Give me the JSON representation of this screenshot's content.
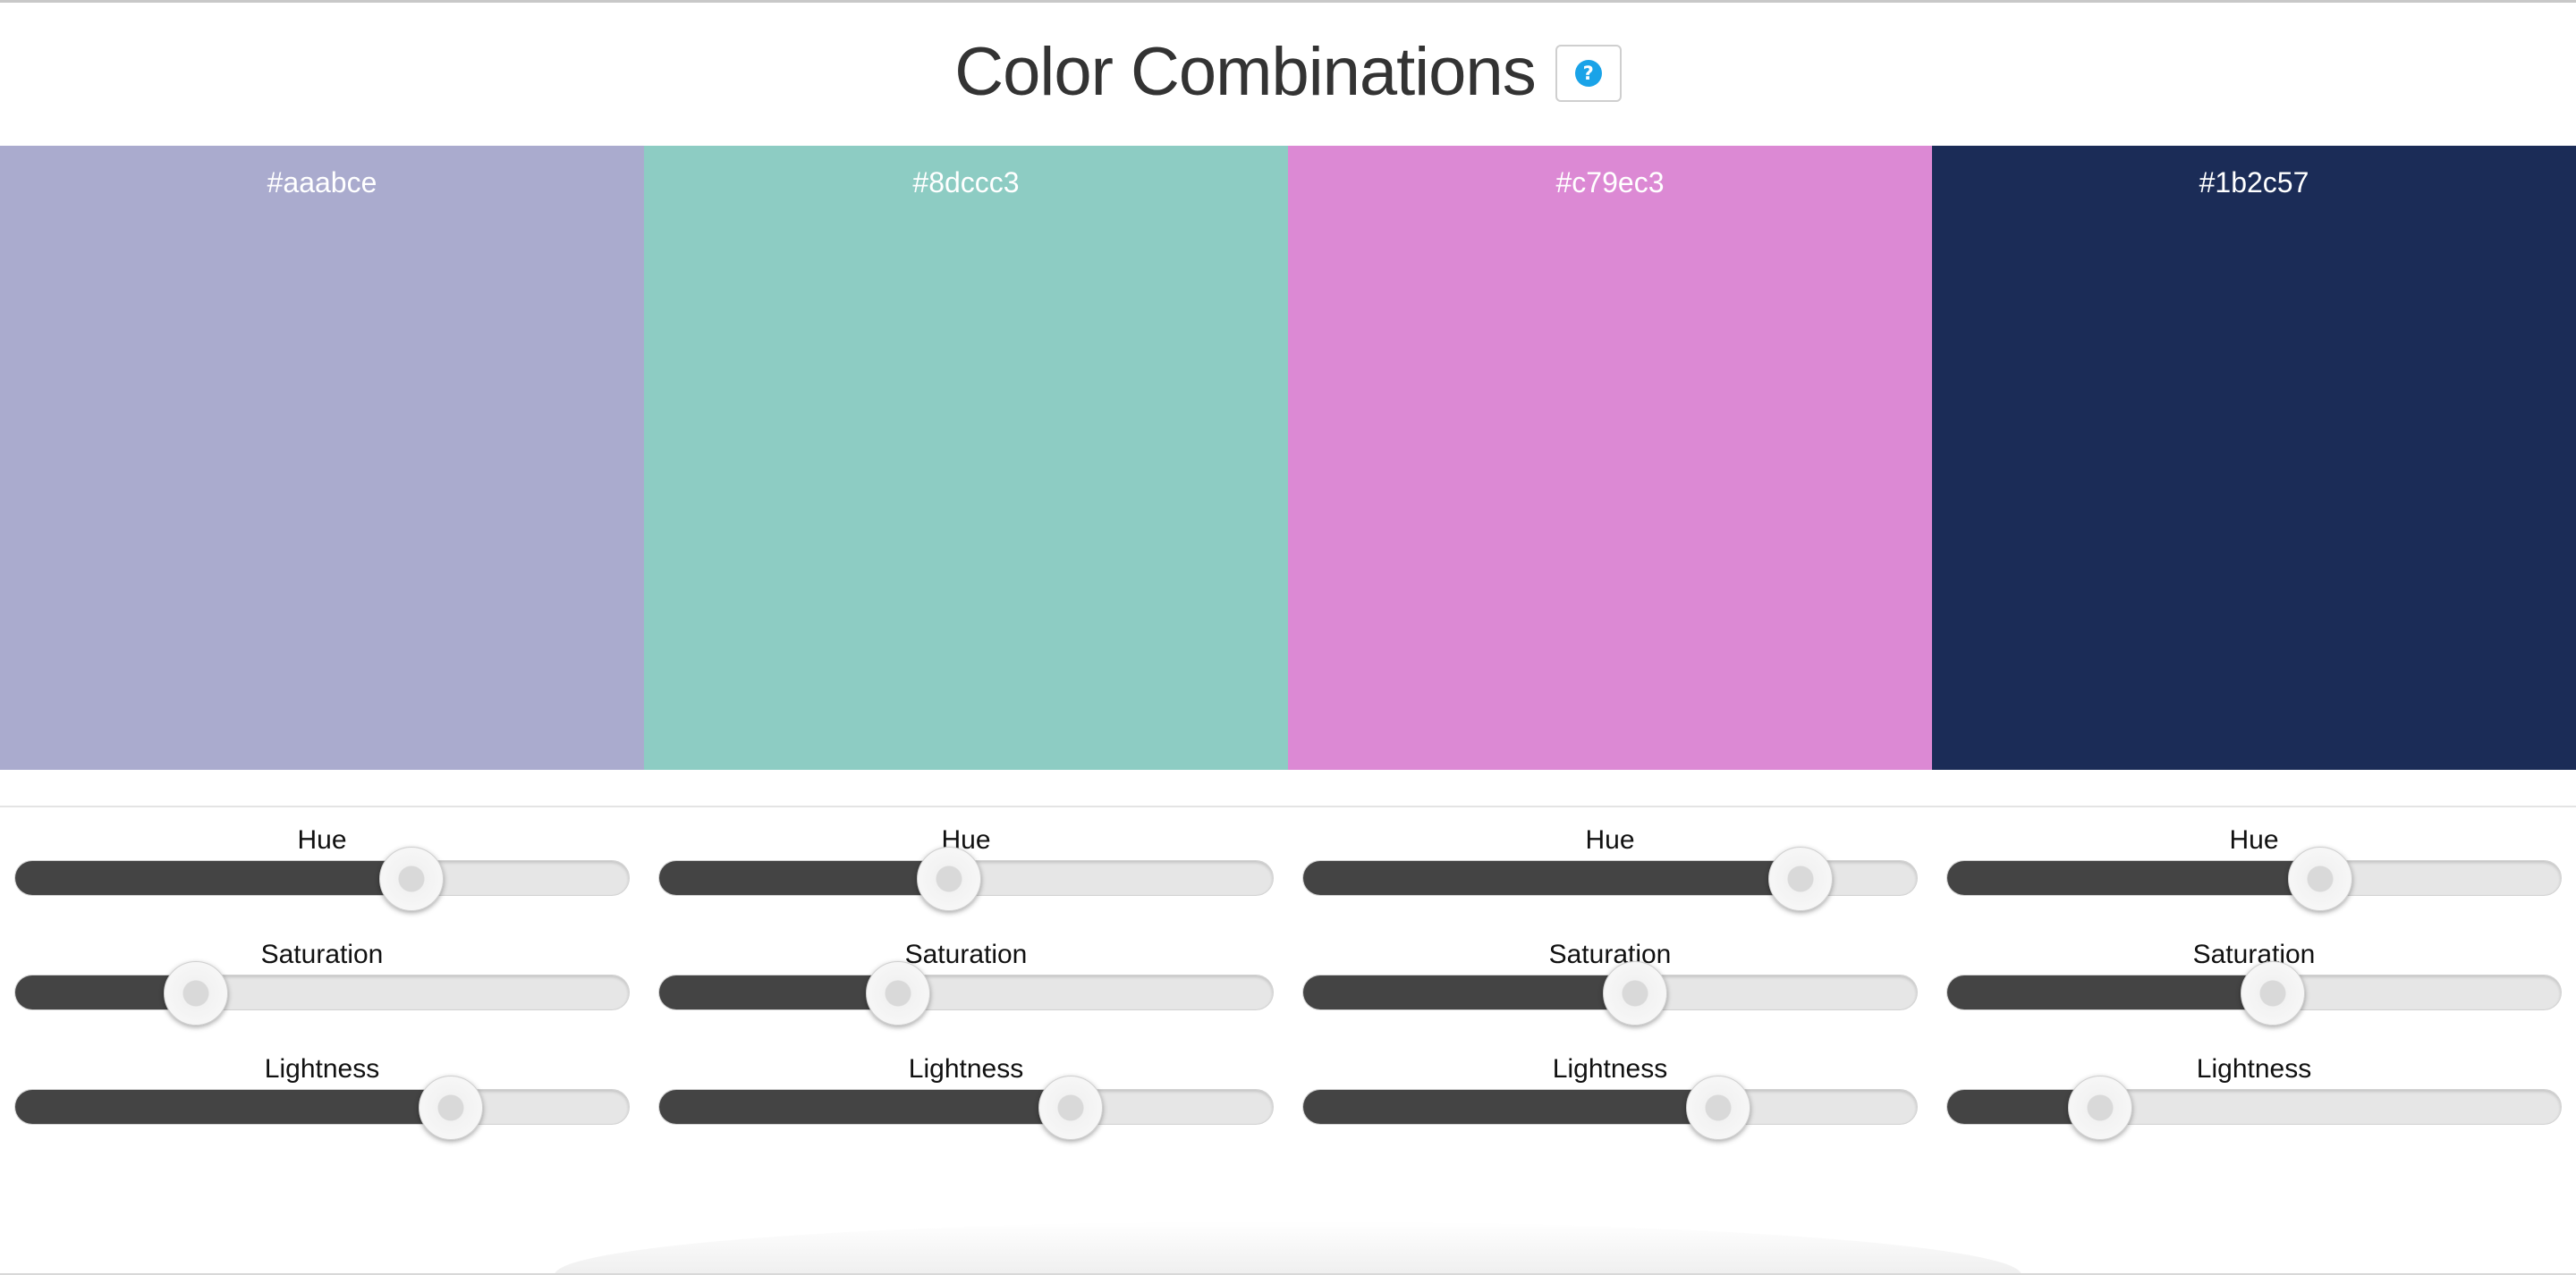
{
  "header": {
    "title": "Color Combinations",
    "help_icon": "question-circle-icon",
    "help_icon_glyph": "?",
    "help_icon_color": "#1aa3e8"
  },
  "swatches": [
    {
      "hex": "#aaabce",
      "color": "#aaabce",
      "controls": {
        "hue": {
          "label": "Hue",
          "value": 0.645
        },
        "saturation": {
          "label": "Saturation",
          "value": 0.295
        },
        "lightness": {
          "label": "Lightness",
          "value": 0.71
        }
      }
    },
    {
      "hex": "#8dccc3",
      "color": "#8dccc3",
      "controls": {
        "hue": {
          "label": "Hue",
          "value": 0.473
        },
        "saturation": {
          "label": "Saturation",
          "value": 0.39
        },
        "lightness": {
          "label": "Lightness",
          "value": 0.67
        }
      }
    },
    {
      "hex": "#c79ec3",
      "color": "#dc89d4",
      "controls": {
        "hue": {
          "label": "Hue",
          "value": 0.81
        },
        "saturation": {
          "label": "Saturation",
          "value": 0.54
        },
        "lightness": {
          "label": "Lightness",
          "value": 0.676
        }
      }
    },
    {
      "hex": "#1b2c57",
      "color": "#1b2c57",
      "controls": {
        "hue": {
          "label": "Hue",
          "value": 0.607
        },
        "saturation": {
          "label": "Saturation",
          "value": 0.53
        },
        "lightness": {
          "label": "Lightness",
          "value": 0.25
        }
      }
    }
  ]
}
